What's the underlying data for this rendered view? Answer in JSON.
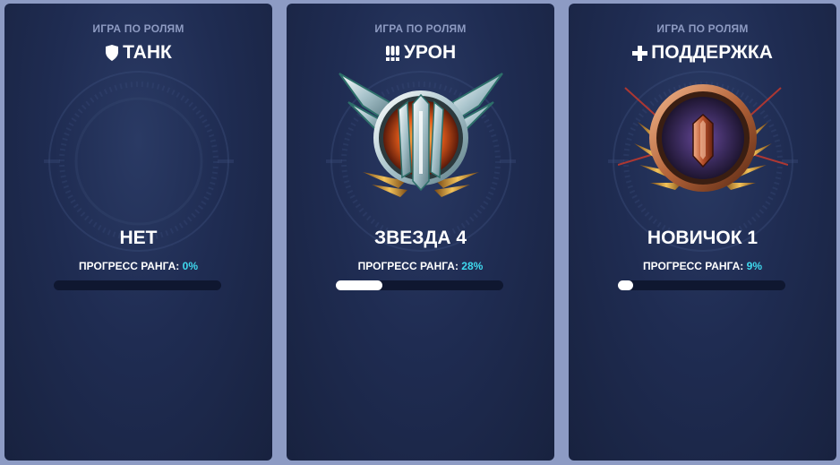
{
  "cards": [
    {
      "mode": "ИГРА ПО РОЛЯМ",
      "role": "ТАНК",
      "role_icon": "shield-icon",
      "rank": "НЕТ",
      "progress_label": "ПРОГРЕСС РАНГА:",
      "progress_value": "0%",
      "progress": 0
    },
    {
      "mode": "ИГРА ПО РОЛЯМ",
      "role": "УРОН",
      "role_icon": "bullets-icon",
      "rank": "ЗВЕЗДА 4",
      "progress_label": "ПРОГРЕСС РАНГА:",
      "progress_value": "28%",
      "progress": 0.28,
      "badge": "rank-badge-star"
    },
    {
      "mode": "ИГРА ПО РОЛЯМ",
      "role": "ПОДДЕРЖКА",
      "role_icon": "plus-icon",
      "rank": "НОВИЧОК 1",
      "progress_label": "ПРОГРЕСС РАНГА:",
      "progress_value": "9%",
      "progress": 0.09,
      "badge": "rank-badge-novice"
    }
  ],
  "colors": {
    "page_bg": "#8d9bc4",
    "card_bg": "#1f2c52",
    "mode_text": "#8e9bc2",
    "progress_accent": "#3fd9ee",
    "bar_track": "#0f1730",
    "bar_fill": "#ffffff"
  }
}
